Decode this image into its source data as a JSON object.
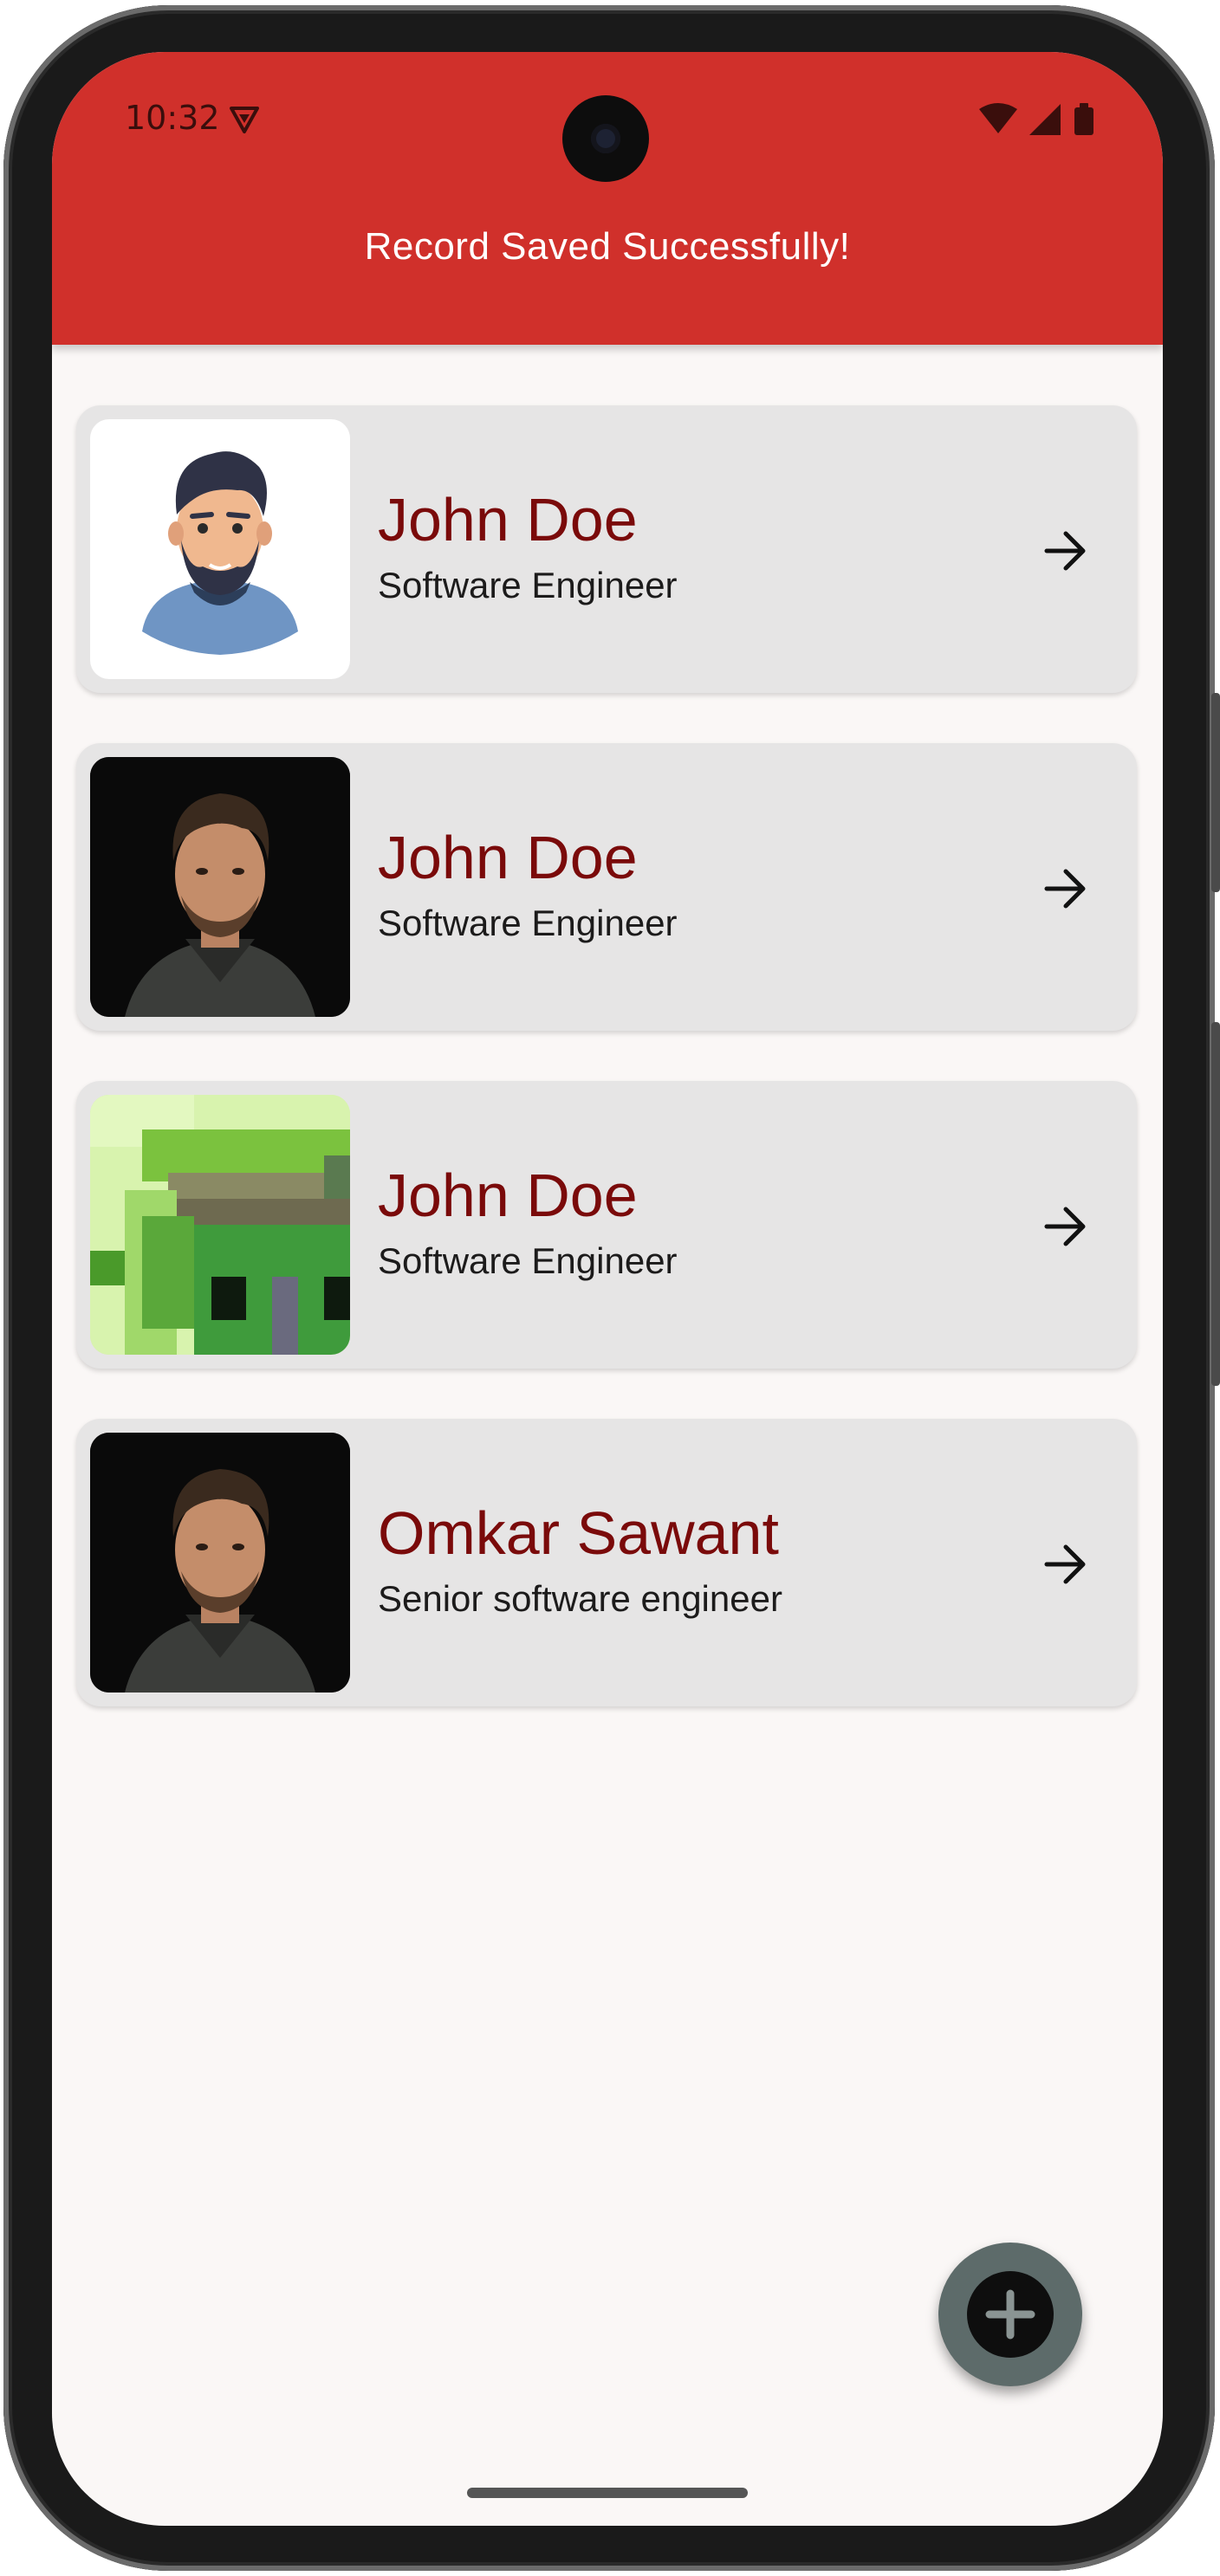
{
  "status_bar": {
    "time": "10:32"
  },
  "app_bar": {
    "title": "Record Saved Successfully!",
    "color": "#d0302b"
  },
  "records": [
    {
      "name": "John Doe",
      "title": "Software Engineer",
      "avatar": "cartoon-man-avatar"
    },
    {
      "name": "John Doe",
      "title": "Software Engineer",
      "avatar": "portrait-photo"
    },
    {
      "name": "John Doe",
      "title": "Software Engineer",
      "avatar": "pixel-art-house"
    },
    {
      "name": "Omkar Sawant",
      "title": "Senior software engineer",
      "avatar": "portrait-photo"
    }
  ],
  "icons": {
    "navigate": "arrow-right-icon",
    "fab": "add-icon"
  },
  "colors": {
    "name_text": "#7a0a0a",
    "card_background": "#e6e5e5",
    "fab": "#5d6b6a"
  }
}
